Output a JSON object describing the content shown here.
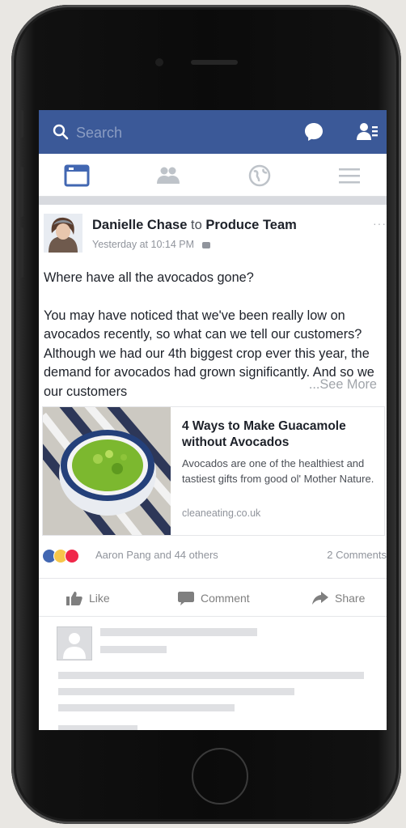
{
  "search": {
    "placeholder": "Search"
  },
  "icons": {
    "search": "search-icon",
    "messenger": "messenger-icon",
    "friend_requests": "friend-requests-icon",
    "news_feed": "news-feed-icon",
    "groups": "groups-icon",
    "notifications": "globe-icon",
    "menu": "menu-icon"
  },
  "colors": {
    "brand": "#3b5998",
    "active_tab": "#4267b2",
    "inactive_tab": "#bec3c9"
  },
  "post": {
    "author": "Danielle Chase",
    "connector": "to",
    "group": "Produce Team",
    "timestamp": "Yesterday at 10:14 PM",
    "headline": "Where have all the avocados gone?",
    "body": "You may have noticed that we've been really low on avocados recently, so what can we tell our customers? Although we had our 4th biggest crop ever this year, the demand for avocados had grown significantly. And so we our customers",
    "see_more": "...See More"
  },
  "link": {
    "title": "4 Ways to Make Guacamole without Avocados",
    "description": "Avocados are one of the healthiest and tastiest gifts from good ol' Mother Nature.",
    "domain": "cleaneating.co.uk"
  },
  "reactions": {
    "names": "Aaron Pang and 44 others",
    "comments": "2 Comments"
  },
  "actions": {
    "like": "Like",
    "comment": "Comment",
    "share": "Share"
  }
}
